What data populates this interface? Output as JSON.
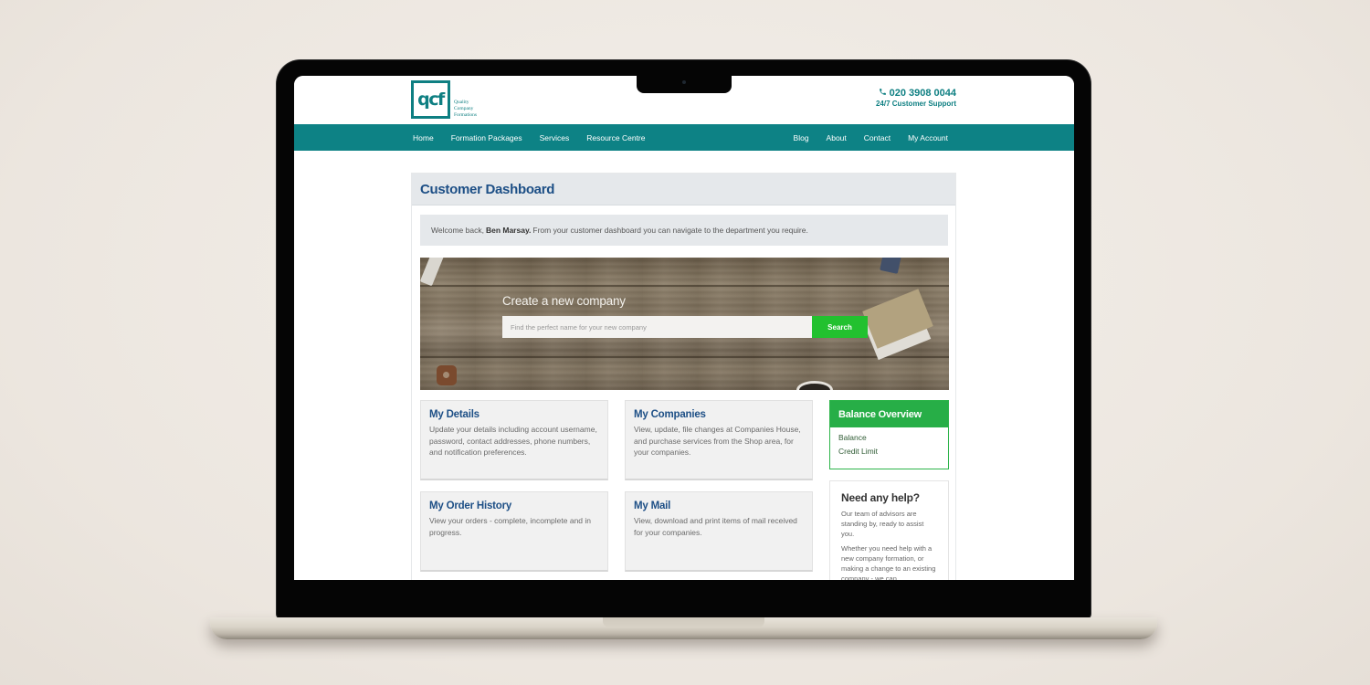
{
  "header": {
    "logo_mark": "qcf",
    "logo_text": [
      "Quality",
      "Company",
      "Formations"
    ],
    "phone_icon": "phone-icon",
    "phone": "020 3908 0044",
    "support": "24/7 Customer Support"
  },
  "nav": {
    "left": [
      {
        "label": "Home"
      },
      {
        "label": "Formation Packages"
      },
      {
        "label": "Services"
      },
      {
        "label": "Resource Centre"
      }
    ],
    "right": [
      {
        "label": "Blog"
      },
      {
        "label": "About"
      },
      {
        "label": "Contact"
      },
      {
        "label": "My Account"
      }
    ]
  },
  "dashboard": {
    "title": "Customer Dashboard",
    "welcome_prefix": "Welcome back,",
    "user_name": "Ben Marsay.",
    "welcome_suffix": "From your customer dashboard you can navigate to the department you require."
  },
  "hero": {
    "title": "Create a new company",
    "search_placeholder": "Find the perfect name for your new company",
    "search_value": "",
    "search_button": "Search"
  },
  "cards": [
    {
      "title": "My Details",
      "desc": "Update your details including account username, password, contact addresses, phone numbers, and notification preferences."
    },
    {
      "title": "My Companies",
      "desc": "View, update, file changes at Companies House, and purchase services from the Shop area, for your companies."
    },
    {
      "title": "My Order History",
      "desc": "View your orders - complete, incomplete and in progress."
    },
    {
      "title": "My Mail",
      "desc": "View, download and print items of mail received for your companies."
    }
  ],
  "balance": {
    "title": "Balance Overview",
    "rows": [
      "Balance",
      "Credit Limit"
    ]
  },
  "help": {
    "title": "Need any help?",
    "p1": "Our team of advisors are standing by, ready to assist you.",
    "p2": "Whether you need help with a new company formation, or making a change to an existing company - we can"
  },
  "colors": {
    "brand_teal": "#0d8285",
    "heading_blue": "#1d4f86",
    "search_green": "#22c12f",
    "balance_green": "#27ae47"
  }
}
